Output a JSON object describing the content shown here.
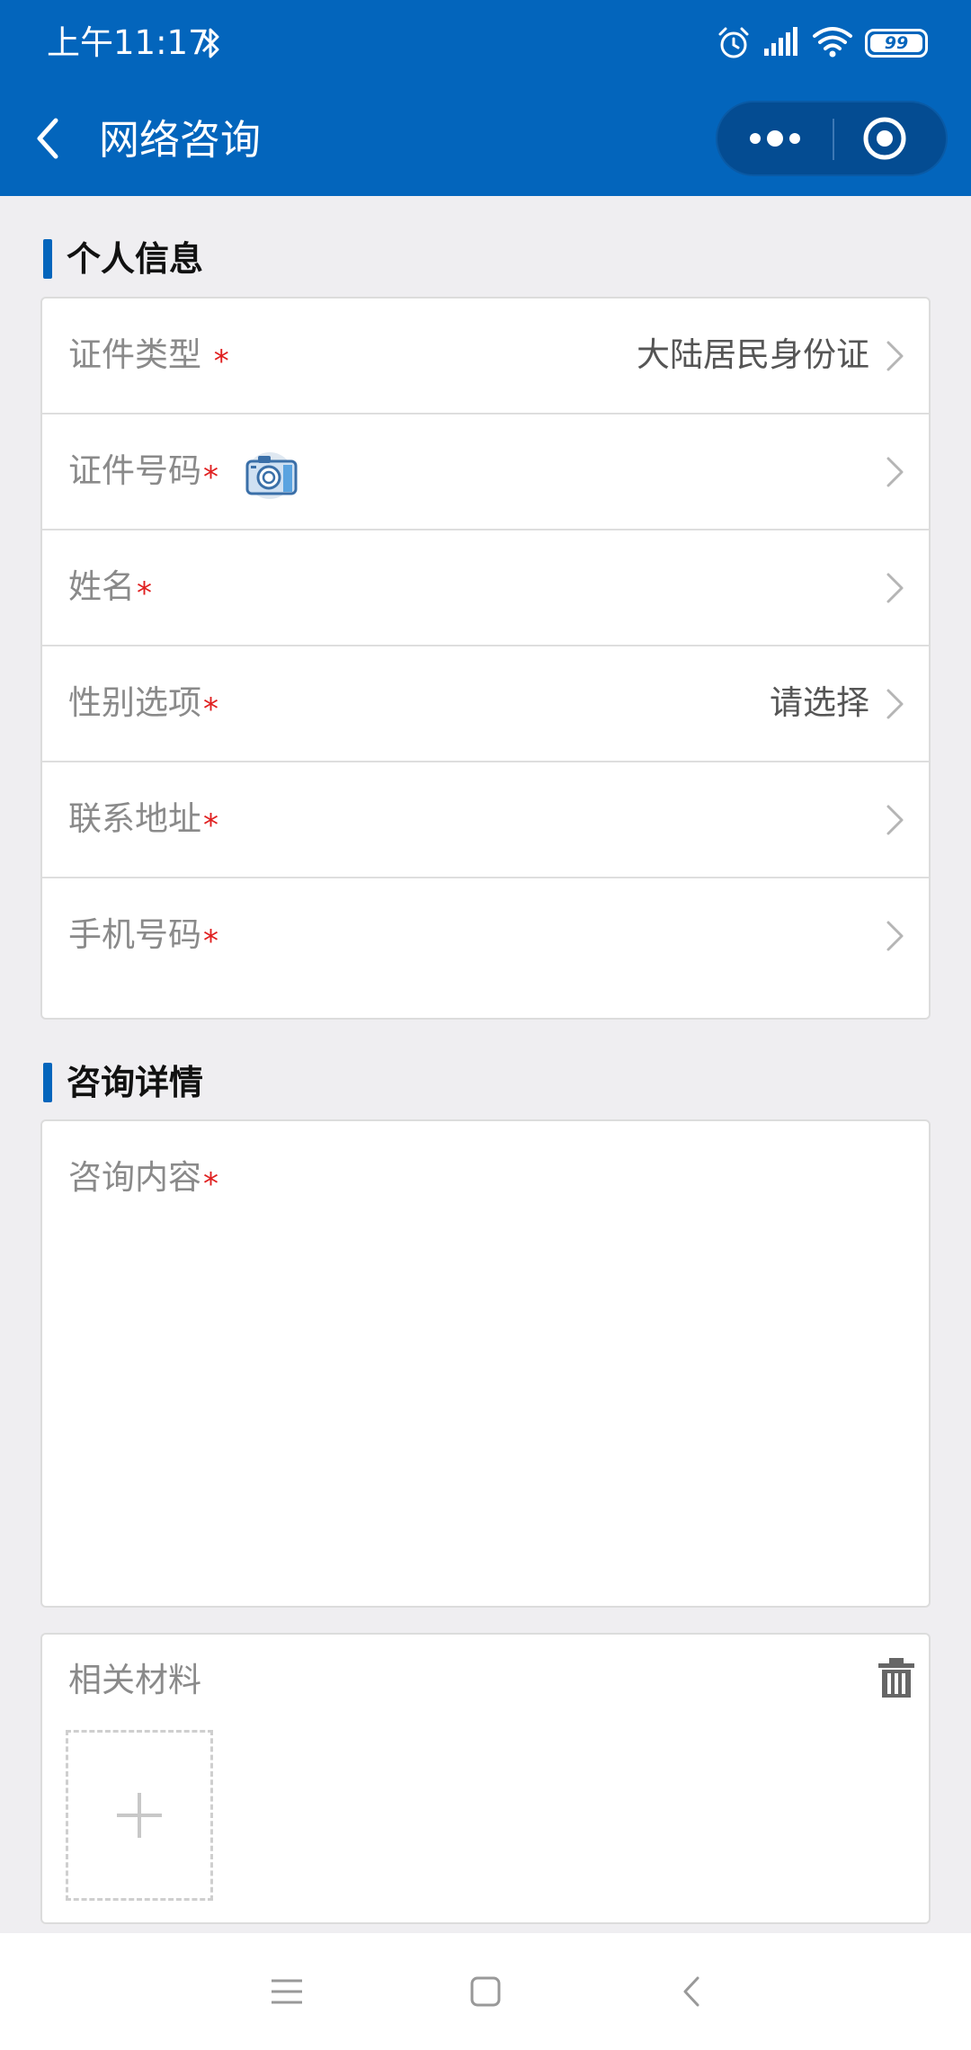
{
  "status_bar": {
    "time": "上午11:17",
    "battery": "99",
    "icons": [
      "bluetooth-icon",
      "alarm-icon",
      "signal-icon",
      "wifi-icon",
      "battery-icon"
    ]
  },
  "nav": {
    "title": "网络咨询",
    "back_icon": "chevron-left-icon",
    "more_icon": "more-dots-icon",
    "close_icon": "target-close-icon"
  },
  "personal_section": {
    "title": "个人信息",
    "rows": [
      {
        "label": "证件类型 ",
        "required": "*",
        "value": "大陆居民身份证"
      },
      {
        "label": "证件号码",
        "required": "*",
        "value": "",
        "icon": "camera-icon"
      },
      {
        "label": "姓名",
        "required": "*",
        "value": ""
      },
      {
        "label": "性别选项",
        "required": "*",
        "value": "请选择"
      },
      {
        "label": "联系地址",
        "required": "*",
        "value": ""
      },
      {
        "label": "手机号码",
        "required": "*",
        "value": ""
      }
    ]
  },
  "consult_section": {
    "title": "咨询详情",
    "content_label": "咨询内容",
    "required": "*",
    "content_value": ""
  },
  "materials": {
    "label": "相关材料",
    "trash_icon": "trash-icon",
    "add_icon": "plus-icon"
  },
  "colors": {
    "brand": "#0365bc",
    "background": "#efeef1",
    "required": "#e02020"
  }
}
